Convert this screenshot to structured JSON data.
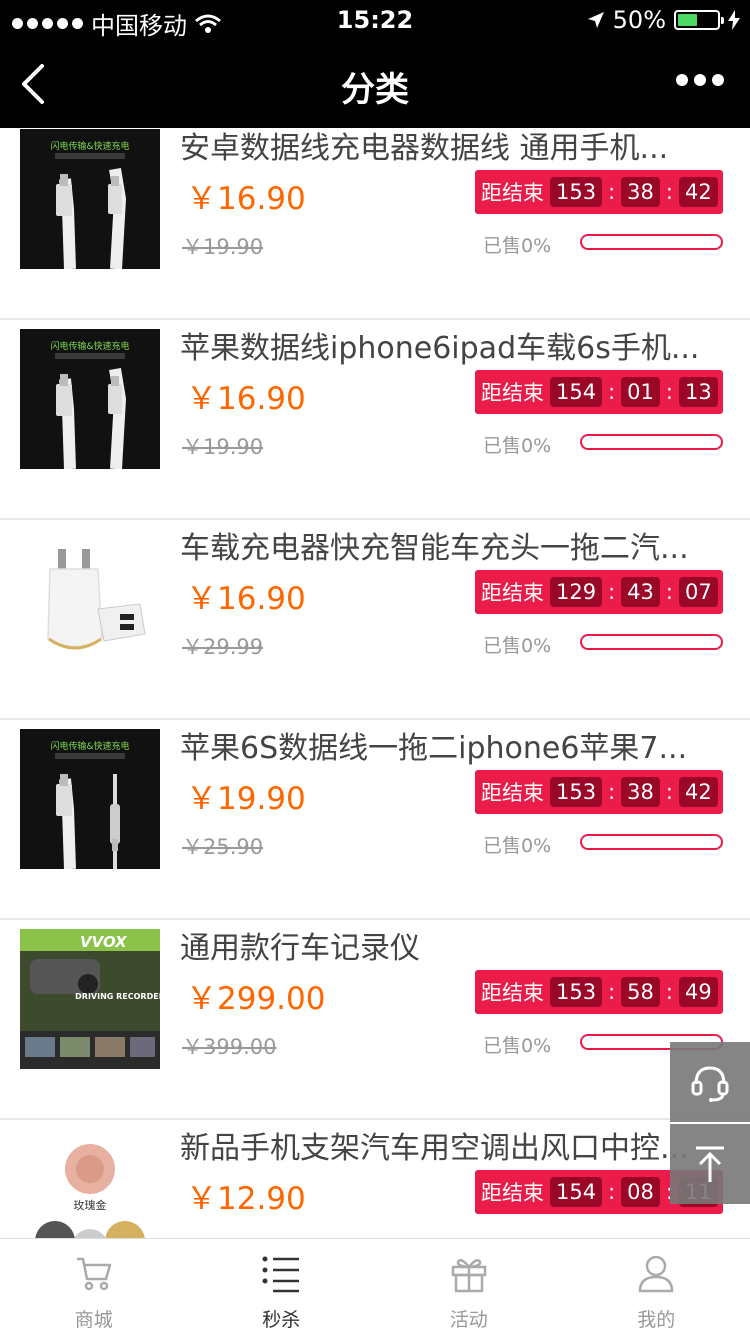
{
  "status_bar": {
    "carrier": "中国移动",
    "time": "15:22",
    "battery": "50%",
    "battery_level": 0.5
  },
  "nav": {
    "title": "分类"
  },
  "currency": "￥",
  "timer_label": "距结束",
  "sold_label": "已售0%",
  "items": [
    {
      "name": "安卓数据线充电器数据线 通用手机...",
      "price": "￥16.90",
      "orig_price": "￥19.90",
      "h": "153",
      "m": "38",
      "s": "42",
      "sold_fraction": 0,
      "image": "cable-android"
    },
    {
      "name": "苹果数据线iphone6ipad车载6s手机...",
      "price": "￥16.90",
      "orig_price": "￥19.90",
      "h": "154",
      "m": "01",
      "s": "13",
      "sold_fraction": 0,
      "image": "cable-apple"
    },
    {
      "name": "车载充电器快充智能车充头一拖二汽...",
      "price": "￥16.90",
      "orig_price": "￥29.99",
      "h": "129",
      "m": "43",
      "s": "07",
      "sold_fraction": 0,
      "image": "car-charger"
    },
    {
      "name": "苹果6S数据线一拖二iphone6苹果7...",
      "price": "￥19.90",
      "orig_price": "￥25.90",
      "h": "153",
      "m": "38",
      "s": "42",
      "sold_fraction": 0,
      "image": "cable-dual"
    },
    {
      "name": "通用款行车记录仪",
      "price": "￥299.00",
      "orig_price": "￥399.00",
      "h": "153",
      "m": "58",
      "s": "49",
      "sold_fraction": 0,
      "image": "dash-cam"
    },
    {
      "name": "新品手机支架汽车用空调出风口中控...",
      "price": "￥12.90",
      "orig_price": "",
      "h": "154",
      "m": "08",
      "s": "11",
      "sold_fraction": 0,
      "image": "phone-holder"
    }
  ],
  "thumb_text": {
    "cable": "闪电传输&快速充电",
    "dashcam_brand": "VVOX",
    "dashcam_text": "DRIVING RECORDER",
    "holder_text": "玫瑰金"
  },
  "tabs": [
    {
      "label": "商城",
      "icon": "cart-icon",
      "active": false
    },
    {
      "label": "秒杀",
      "icon": "list-icon",
      "active": true
    },
    {
      "label": "活动",
      "icon": "gift-icon",
      "active": false
    },
    {
      "label": "我的",
      "icon": "user-icon",
      "active": false
    }
  ],
  "colors": {
    "accent": "#ec1c4a",
    "price": "#ff6600",
    "timer_box": "#9b0726"
  }
}
